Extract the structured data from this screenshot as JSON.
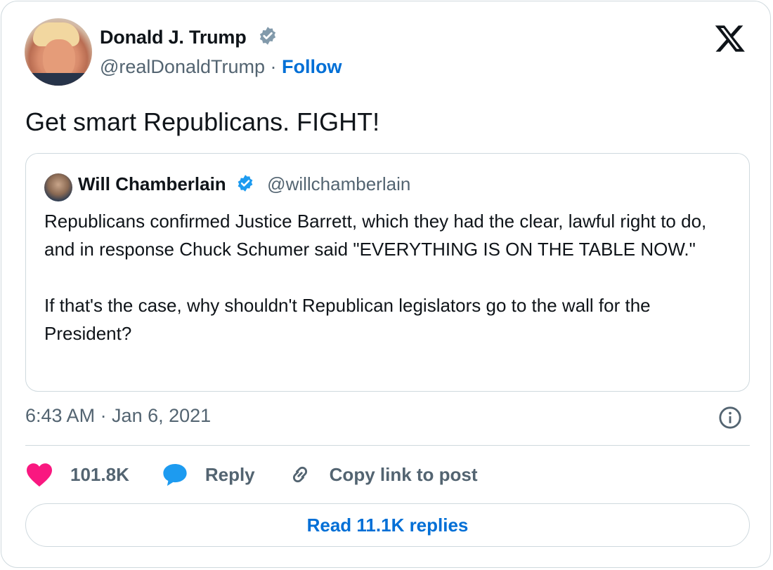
{
  "tweet": {
    "author_name": "Donald J. Trump",
    "author_handle": "@realDonaldTrump",
    "separator": " · ",
    "follow_label": "Follow",
    "text": "Get smart Republicans. FIGHT!",
    "timestamp": "6:43 AM · Jan 6, 2021"
  },
  "quote": {
    "author_name": "Will Chamberlain",
    "author_handle": "@willchamberlain",
    "text": "Republicans confirmed Justice Barrett, which they had the clear, lawful right to do, and in response Chuck Schumer said \"EVERYTHING IS ON THE TABLE NOW.\"\n\nIf that's the case, why shouldn't Republican legislators go to the wall for the President?"
  },
  "actions": {
    "likes": "101.8K",
    "reply_label": "Reply",
    "copy_label": "Copy link to post"
  },
  "read_replies_label": "Read 11.1K replies",
  "colors": {
    "like": "#f91880",
    "reply": "#1d9bf0",
    "link": "#006fd6",
    "muted": "#536471",
    "border": "#cfd9de",
    "verified_gray": "#829aab",
    "verified_blue": "#1d9bf0"
  },
  "icons": [
    "x-logo-icon",
    "verified-gray-icon",
    "verified-blue-icon",
    "info-icon",
    "heart-icon",
    "reply-bubble-icon",
    "link-icon"
  ]
}
